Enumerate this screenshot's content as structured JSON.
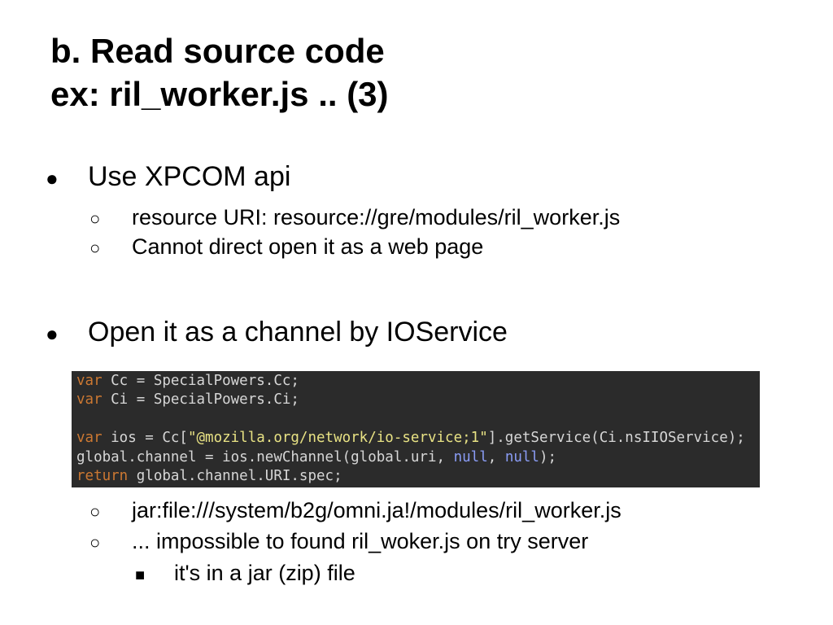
{
  "title": {
    "line1": "b. Read source code",
    "line2": "ex: ril_worker.js .. (3)"
  },
  "bullets": [
    {
      "marker": "●",
      "text": "Use XPCOM api",
      "subitems": [
        {
          "marker": "○",
          "text": "resource URI: resource://gre/modules/ril_worker.js"
        },
        {
          "marker": "○",
          "text": "Cannot direct open it as a web page"
        }
      ]
    },
    {
      "marker": "●",
      "text": "Open it as a channel by IOService",
      "subitems": [
        {
          "marker": "○",
          "text": "jar:file:///system/b2g/omni.ja!/modules/ril_worker.js"
        },
        {
          "marker": "○",
          "text": "... impossible to found ril_woker.js on try server"
        }
      ],
      "subsubitems": [
        {
          "marker": "■",
          "text": "it's in a jar (zip) file"
        }
      ]
    }
  ],
  "code": {
    "line1": {
      "kw": "var",
      "rest": " Cc = SpecialPowers.Cc;"
    },
    "line2": {
      "kw": "var",
      "rest": " Ci = SpecialPowers.Ci;"
    },
    "line3": {
      "text": ""
    },
    "line4": {
      "kw": "var",
      "pre": " ios = Cc[",
      "str": "\"@mozilla.org/network/io-service;1\"",
      "post": "].getService(Ci.nsIIOService);"
    },
    "line5": {
      "pre": "global.channel = ios.newChannel(global.uri, ",
      "null1": "null",
      "mid": ", ",
      "null2": "null",
      "post": ");"
    },
    "line6": {
      "kw": "return",
      "rest": " global.channel.URI.spec;"
    }
  },
  "colors": {
    "code_background": "#2b2b2b",
    "keyword": "#cc7832",
    "string": "#e8e284",
    "null_literal": "#8a9cf5"
  }
}
